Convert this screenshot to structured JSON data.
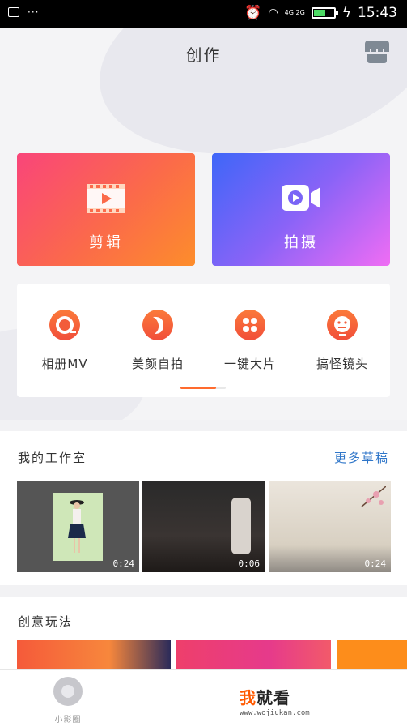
{
  "status_bar": {
    "time": "15:43",
    "network": "4G 2G"
  },
  "header": {
    "title": "创作"
  },
  "cards": [
    {
      "label": "剪辑"
    },
    {
      "label": "拍摄"
    }
  ],
  "tools": [
    {
      "label": "相册MV"
    },
    {
      "label": "美颜自拍"
    },
    {
      "label": "一键大片"
    },
    {
      "label": "搞怪镜头"
    }
  ],
  "studio": {
    "title": "我的工作室",
    "more": "更多草稿",
    "drafts": [
      {
        "duration": "0:24"
      },
      {
        "duration": "0:06"
      },
      {
        "duration": "0:24"
      }
    ]
  },
  "creative": {
    "title": "创意玩法"
  },
  "tabbar": {
    "home_label": "小影圈"
  },
  "watermark": {
    "brand_a": "我",
    "brand_b": "就看",
    "domain": "www.wojiukan.com"
  },
  "colors": {
    "accent": "#ff6b2e",
    "link": "#2f76c9"
  }
}
